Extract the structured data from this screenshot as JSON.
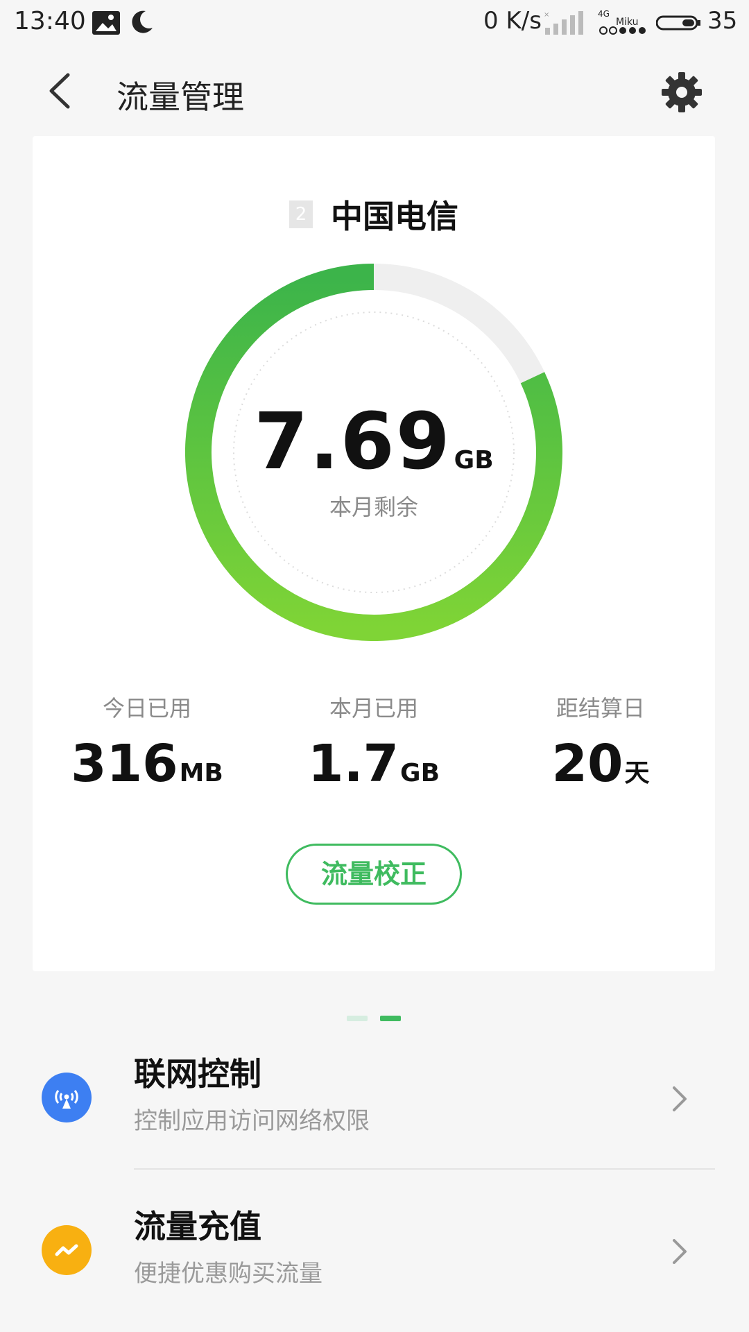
{
  "status_bar": {
    "time": "13:40",
    "net_speed": "0 K/s",
    "net_type": "4G",
    "carrier_tag": "Miku",
    "battery": "35",
    "icons": [
      "gallery-icon",
      "moon-icon",
      "signal-icon",
      "battery-icon"
    ]
  },
  "header": {
    "title": "流量管理",
    "back_icon": "back-arrow-icon",
    "settings_icon": "gear-icon"
  },
  "card": {
    "sim_slot": "2",
    "carrier": "中国电信",
    "remaining": {
      "value": "7.69",
      "unit": "GB",
      "label": "本月剩余"
    },
    "usage_ring": {
      "remaining_fraction": 0.82,
      "colors": {
        "start": "#3cb44a",
        "end": "#7fd436",
        "track": "#efefef"
      }
    },
    "stats": [
      {
        "label": "今日已用",
        "value": "316",
        "unit": "MB"
      },
      {
        "label": "本月已用",
        "value": "1.7",
        "unit": "GB"
      },
      {
        "label": "距结算日",
        "value": "20",
        "unit": "天"
      }
    ],
    "calibrate_label": "流量校正"
  },
  "pager": {
    "pages": 2,
    "active": 1,
    "active_color": "#3fbb5f",
    "inactive_color": "#d6ede0"
  },
  "list": [
    {
      "title": "联网控制",
      "subtitle": "控制应用访问网络权限",
      "icon": "network-tower-icon",
      "icon_color": "#3d7ff2"
    },
    {
      "title": "流量充值",
      "subtitle": "便捷优惠购买流量",
      "icon": "trend-icon",
      "icon_color": "#f8b011"
    }
  ],
  "accent_color": "#3fbb5f"
}
